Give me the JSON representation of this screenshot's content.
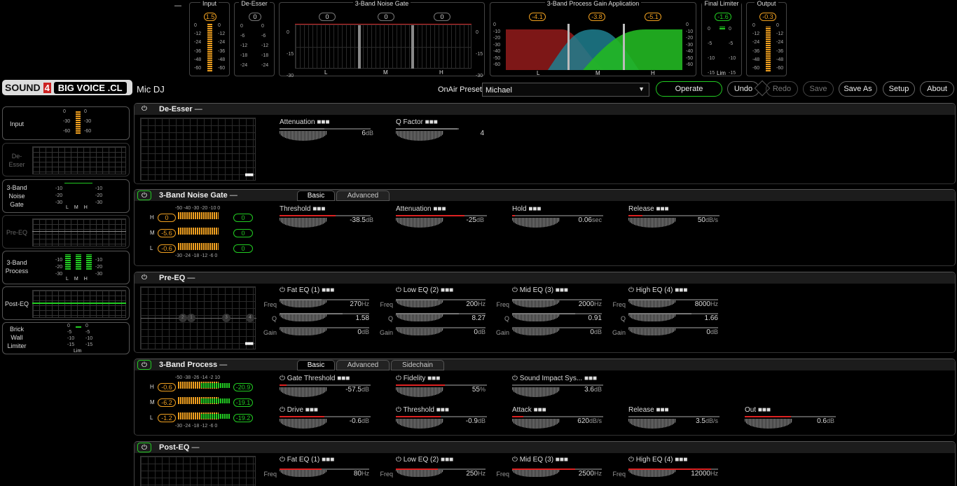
{
  "top_meters": {
    "dash": "—",
    "input": {
      "title": "Input",
      "value": "1.5",
      "ticks": [
        "0",
        "-12",
        "-24",
        "-36",
        "-48",
        "-60"
      ],
      "level": 0.95
    },
    "de_esser": {
      "title": "De-Esser",
      "value": "0",
      "ticks": [
        "0",
        "-6",
        "-12",
        "-18",
        "-24"
      ]
    },
    "noise_gate": {
      "title": "3-Band Noise Gate",
      "values": [
        "0",
        "0",
        "0"
      ],
      "ticks_left": [
        "0",
        "-15",
        "-30"
      ],
      "ticks_right": [
        "0",
        "-15",
        "-30"
      ],
      "bands": [
        "L",
        "M",
        "H"
      ]
    },
    "process": {
      "title": "3-Band Process Gain Application",
      "values": [
        "-4.1",
        "-3.8",
        "-5.1"
      ],
      "ticks": [
        "0",
        "-10",
        "-20",
        "-30",
        "-40",
        "-50",
        "-60"
      ],
      "bands": [
        "L",
        "M",
        "H"
      ],
      "colors": [
        "#8b1a1a",
        "#1e7f8f",
        "#22b822"
      ]
    },
    "limiter": {
      "title": "Final Limiter",
      "value": "-1.6",
      "ticks": [
        "0",
        "-5",
        "-10",
        "-15"
      ],
      "lim": "Lim"
    },
    "output": {
      "title": "Output",
      "value": "-0.3",
      "ticks": [
        "0",
        "-12",
        "-24",
        "-36",
        "-48",
        "-60"
      ],
      "level": 0.9
    }
  },
  "header": {
    "logo_a": "SOUND",
    "logo_mark": "4",
    "logo_b": "BIG VOICE .CL",
    "preset_name": "Mic DJ",
    "onair_label": "OnAir Preset:",
    "onair_value": "Michael",
    "operate": "Operate",
    "undo": "Undo",
    "redo": "Redo",
    "save": "Save",
    "save_as": "Save As",
    "setup": "Setup",
    "about": "About"
  },
  "sidebar": {
    "input": {
      "label": "Input",
      "ticks": [
        "0",
        "-30",
        "-60"
      ]
    },
    "de_esser": "De-\nEsser",
    "noise_gate": {
      "label": "3-Band\nNoise\nGate",
      "ticks": [
        "-10",
        "-20",
        "-30"
      ],
      "bands": [
        "L",
        "M",
        "H"
      ]
    },
    "pre_eq": "Pre-EQ",
    "process": {
      "label": "3-Band\nProcess",
      "ticks": [
        "-10",
        "-20",
        "-30"
      ],
      "bands": [
        "L",
        "M",
        "H"
      ]
    },
    "post_eq": "Post-EQ",
    "limiter": {
      "label": "Brick\nWall\nLimiter",
      "ticks": [
        "0",
        "-5",
        "-10",
        "-15"
      ],
      "lim": "Lim"
    }
  },
  "de_esser": {
    "title": "De-Esser",
    "dash": "—",
    "dots": "■■■",
    "attenuation": {
      "label": "Attenuation ■■■",
      "value": "6",
      "unit": "dB"
    },
    "q_factor": {
      "label": "Q Factor ■■■",
      "value": "4",
      "unit": ""
    }
  },
  "noise_gate": {
    "title": "3-Band Noise Gate",
    "dash": "—",
    "tabs": [
      "Basic",
      "Advanced"
    ],
    "scale": "-50 -40 -30 -20 -10 0",
    "scale_bottom": "-30 -24 -18 -12 -6 0",
    "rows": [
      {
        "band": "H",
        "left": "0",
        "right": "0"
      },
      {
        "band": "M",
        "left": "-5.6",
        "right": "0"
      },
      {
        "band": "L",
        "left": "-0.6",
        "right": "0"
      }
    ],
    "threshold": {
      "label": "Threshold ■■■",
      "value": "-38.5",
      "unit": "dB"
    },
    "attenuation": {
      "label": "Attenuation ■■■",
      "value": "-25",
      "unit": "dB"
    },
    "hold": {
      "label": "Hold ■■■",
      "value": "0.06",
      "unit": "sec"
    },
    "release": {
      "label": "Release ■■■",
      "value": "50",
      "unit": "dB/s"
    }
  },
  "pre_eq": {
    "title": "Pre-EQ",
    "dash": "—",
    "dots": "■■■",
    "nodes": [
      "2",
      "1",
      "3",
      "4"
    ],
    "row_labels": [
      "Freq",
      "Q",
      "Gain"
    ],
    "bands": [
      {
        "label": "Fat EQ (1) ■■■",
        "freq": "270",
        "q": "1.58",
        "gain": "0"
      },
      {
        "label": "Low EQ (2) ■■■",
        "freq": "200",
        "q": "8.27",
        "gain": "0"
      },
      {
        "label": "Mid EQ (3) ■■■",
        "freq": "2000",
        "q": "0.91",
        "gain": "0"
      },
      {
        "label": "High EQ (4) ■■■",
        "freq": "8000",
        "q": "1.66",
        "gain": "0"
      }
    ],
    "units": {
      "hz": "Hz",
      "db": "dB"
    }
  },
  "process": {
    "title": "3-Band Process",
    "dash": "—",
    "tabs": [
      "Basic",
      "Advanced",
      "Sidechain"
    ],
    "scale": "-50 -38 -26 -14 -2 10",
    "scale_bottom": "-30 -24 -18 -12 -6 0",
    "rows": [
      {
        "band": "H",
        "left": "-0.6",
        "right": "-20.9"
      },
      {
        "band": "M",
        "left": "-6.2",
        "right": "-19.1"
      },
      {
        "band": "L",
        "left": "-1.2",
        "right": "-19.2"
      }
    ],
    "gate_threshold": {
      "label": "Gate Threshold ■■■",
      "value": "-57.5",
      "unit": "dB"
    },
    "fidelity": {
      "label": "Fidelity ■■■",
      "value": "55",
      "unit": "%"
    },
    "sound_impact": {
      "label": "Sound Impact Sys... ■■■",
      "value": "3.6",
      "unit": "dB"
    },
    "drive": {
      "label": "Drive ■■■",
      "value": "-0.6",
      "unit": "dB"
    },
    "threshold": {
      "label": "Threshold ■■■",
      "value": "-0.9",
      "unit": "dB"
    },
    "attack": {
      "label": "Attack ■■■",
      "value": "620",
      "unit": "dB/s"
    },
    "release": {
      "label": "Release ■■■",
      "value": "3.5",
      "unit": "dB/s"
    },
    "out": {
      "label": "Out ■■■",
      "value": "0.6",
      "unit": "dB"
    }
  },
  "post_eq": {
    "title": "Post-EQ",
    "dash": "—",
    "row_label": "Freq",
    "bands": [
      {
        "label": "Fat EQ (1) ■■■",
        "freq": "80"
      },
      {
        "label": "Low EQ (2) ■■■",
        "freq": "250"
      },
      {
        "label": "Mid EQ (3) ■■■",
        "freq": "2500"
      },
      {
        "label": "High EQ (4) ■■■",
        "freq": "12000"
      }
    ],
    "unit": "Hz"
  },
  "icons": {
    "power": "power-icon",
    "dropdown": "chevron-down-icon"
  },
  "colors": {
    "accent_green": "#22cc22",
    "meter_orange": "#f0a020",
    "knob_red": "#dd2222"
  }
}
